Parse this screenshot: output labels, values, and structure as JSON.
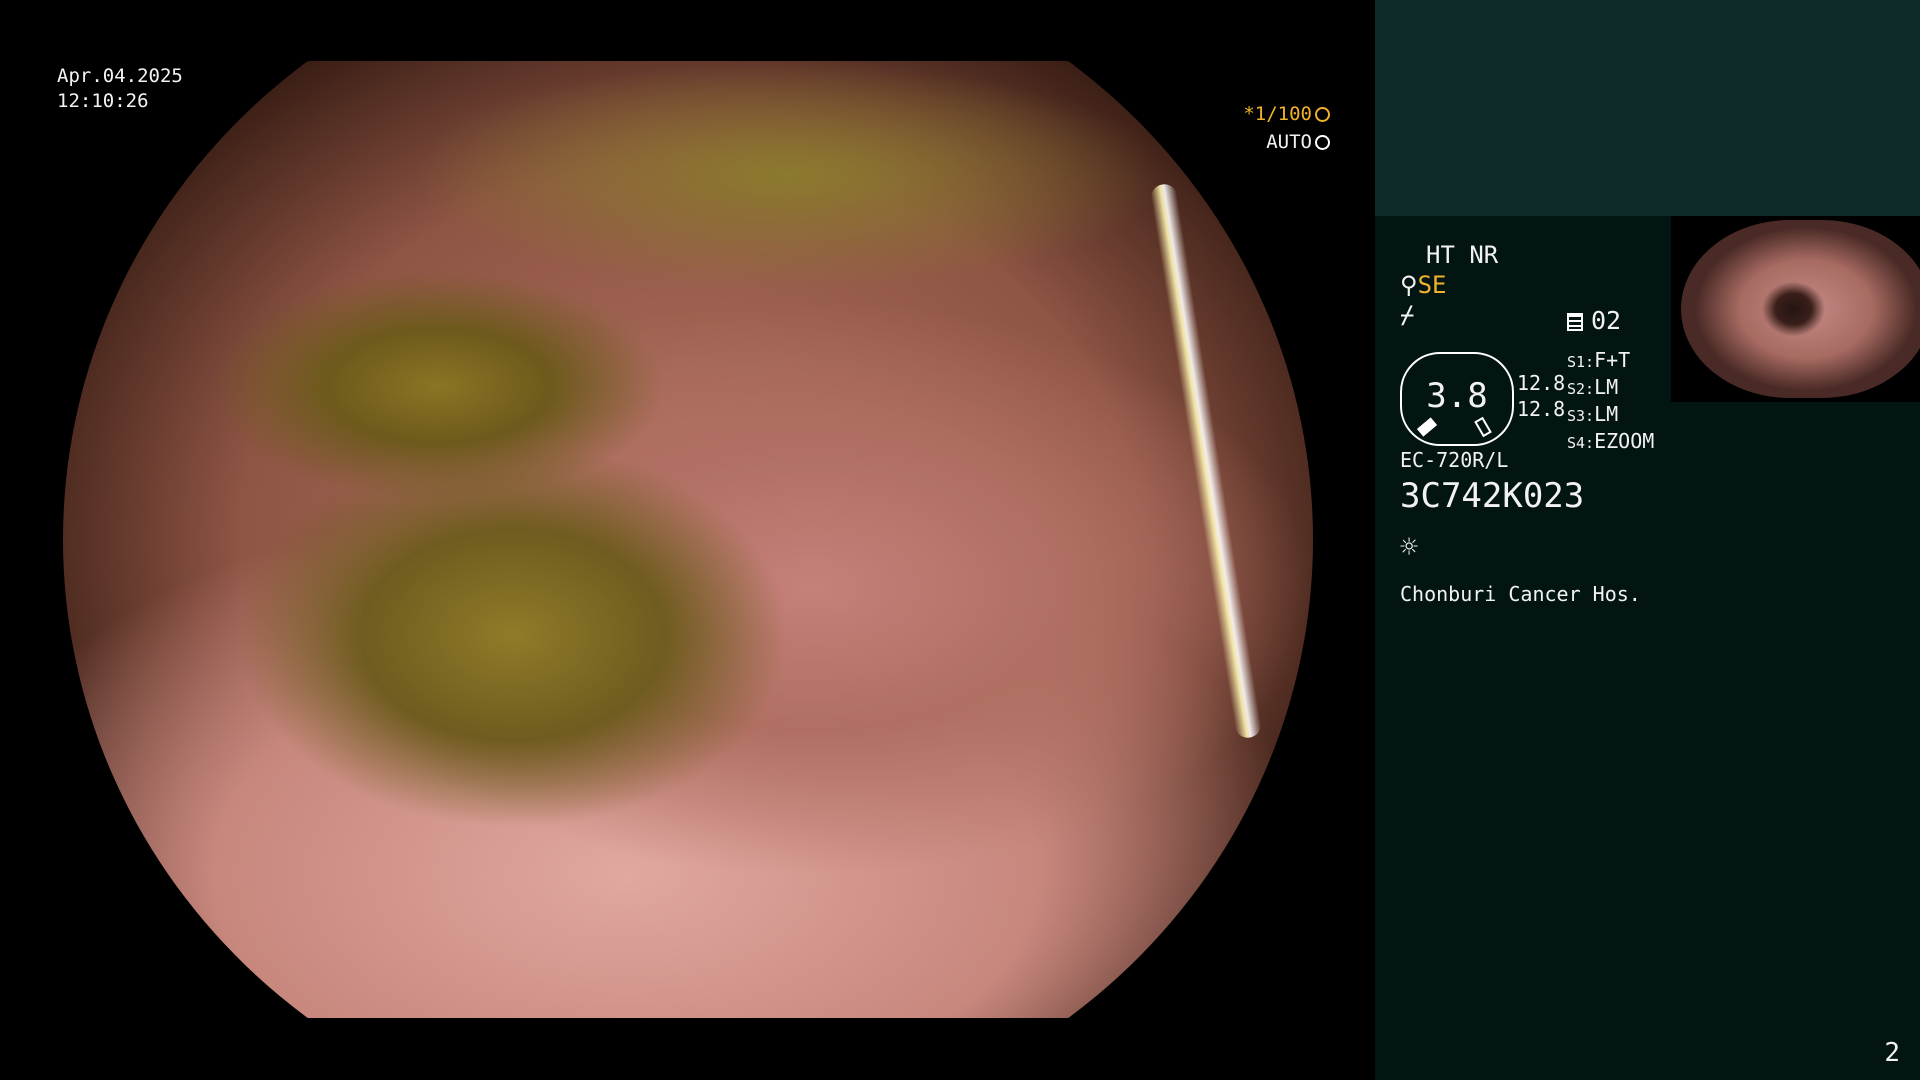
{
  "overlay": {
    "date": "Apr.04.2025",
    "time": "12:10:26",
    "shutter_value": "*1/100",
    "auto_label": "AUTO"
  },
  "panel": {
    "mode1": "HT NR",
    "enhancement": "SE",
    "mode_number": "02",
    "dial_value": "3.8",
    "num1": "12.8",
    "num2": "12.8",
    "settings": [
      {
        "key": "S1:",
        "value": "F+T"
      },
      {
        "key": "S2:",
        "value": "LM"
      },
      {
        "key": "S3:",
        "value": "LM"
      },
      {
        "key": "S4:",
        "value": "EZOOM"
      }
    ],
    "scope_model": "EC-720R/L",
    "serial": "3C742K023",
    "hospital": "Chonburi Cancer Hos.",
    "page": "2"
  },
  "icons": {
    "shutter": "shutter-icon",
    "auto": "iris-icon",
    "sun": "light-icon",
    "enhance": "enhance-icon"
  },
  "colors": {
    "accent": "#f0b22b",
    "panel_bg": "#031513",
    "panel_top": "#0e2a29"
  }
}
